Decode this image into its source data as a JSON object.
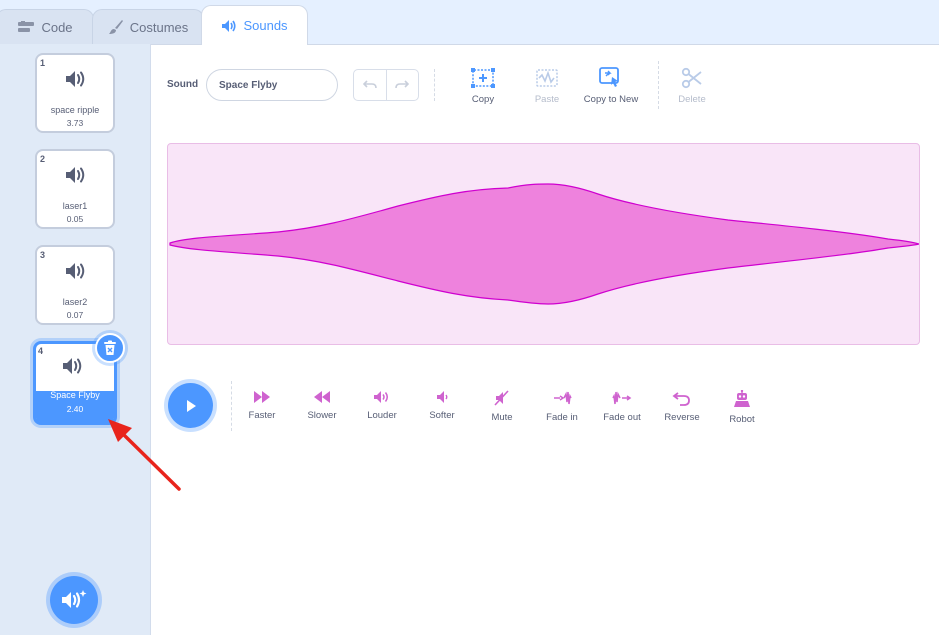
{
  "tabs": [
    {
      "label": "Code",
      "icon": "code-icon"
    },
    {
      "label": "Costumes",
      "icon": "brush-icon"
    },
    {
      "label": "Sounds",
      "icon": "speaker-icon",
      "active": true
    }
  ],
  "sounds": [
    {
      "number": "1",
      "name": "space ripple",
      "duration": "3.73"
    },
    {
      "number": "2",
      "name": "laser1",
      "duration": "0.05"
    },
    {
      "number": "3",
      "name": "laser2",
      "duration": "0.07"
    },
    {
      "number": "4",
      "name": "Space Flyby",
      "duration": "2.40",
      "selected": true
    }
  ],
  "editor": {
    "sound_label": "Sound",
    "sound_name": "Space Flyby",
    "tools": [
      {
        "label": "Copy",
        "icon": "copy-icon",
        "enabled": true
      },
      {
        "label": "Paste",
        "icon": "paste-icon",
        "enabled": false
      },
      {
        "label": "Copy to New",
        "icon": "copy-to-new-icon",
        "enabled": true
      },
      {
        "label": "Delete",
        "icon": "scissors-icon",
        "enabled": false
      }
    ],
    "effects": [
      {
        "label": "Faster",
        "icon": "faster-icon"
      },
      {
        "label": "Slower",
        "icon": "slower-icon"
      },
      {
        "label": "Louder",
        "icon": "louder-icon"
      },
      {
        "label": "Softer",
        "icon": "softer-icon"
      },
      {
        "label": "Mute",
        "icon": "mute-icon"
      },
      {
        "label": "Fade in",
        "icon": "fade-in-icon"
      },
      {
        "label": "Fade out",
        "icon": "fade-out-icon"
      },
      {
        "label": "Reverse",
        "icon": "reverse-icon"
      },
      {
        "label": "Robot",
        "icon": "robot-icon"
      }
    ]
  },
  "colors": {
    "accent": "#4c97ff",
    "waveform_fill": "#ee82dd",
    "waveform_stroke": "#cf00cf",
    "waveform_bg": "#f9e5f8",
    "effect_icon": "#cf63cf",
    "annotation_arrow": "#e8241c"
  }
}
